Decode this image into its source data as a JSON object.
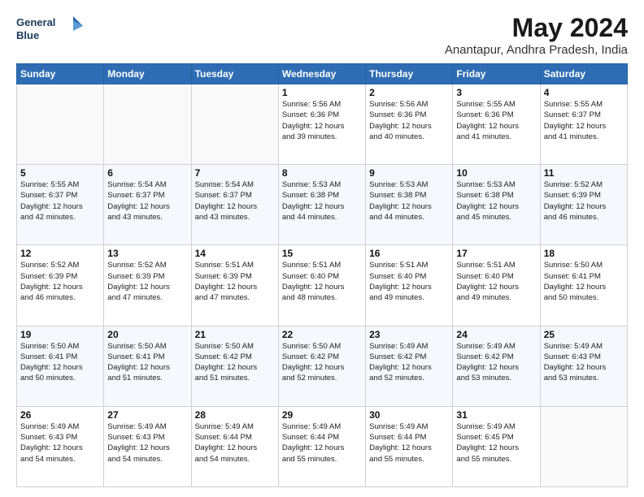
{
  "logo": {
    "line1": "General",
    "line2": "Blue"
  },
  "title": "May 2024",
  "subtitle": "Anantapur, Andhra Pradesh, India",
  "days_of_week": [
    "Sunday",
    "Monday",
    "Tuesday",
    "Wednesday",
    "Thursday",
    "Friday",
    "Saturday"
  ],
  "weeks": [
    [
      {
        "day": "",
        "info": ""
      },
      {
        "day": "",
        "info": ""
      },
      {
        "day": "",
        "info": ""
      },
      {
        "day": "1",
        "info": "Sunrise: 5:56 AM\nSunset: 6:36 PM\nDaylight: 12 hours\nand 39 minutes."
      },
      {
        "day": "2",
        "info": "Sunrise: 5:56 AM\nSunset: 6:36 PM\nDaylight: 12 hours\nand 40 minutes."
      },
      {
        "day": "3",
        "info": "Sunrise: 5:55 AM\nSunset: 6:36 PM\nDaylight: 12 hours\nand 41 minutes."
      },
      {
        "day": "4",
        "info": "Sunrise: 5:55 AM\nSunset: 6:37 PM\nDaylight: 12 hours\nand 41 minutes."
      }
    ],
    [
      {
        "day": "5",
        "info": "Sunrise: 5:55 AM\nSunset: 6:37 PM\nDaylight: 12 hours\nand 42 minutes."
      },
      {
        "day": "6",
        "info": "Sunrise: 5:54 AM\nSunset: 6:37 PM\nDaylight: 12 hours\nand 43 minutes."
      },
      {
        "day": "7",
        "info": "Sunrise: 5:54 AM\nSunset: 6:37 PM\nDaylight: 12 hours\nand 43 minutes."
      },
      {
        "day": "8",
        "info": "Sunrise: 5:53 AM\nSunset: 6:38 PM\nDaylight: 12 hours\nand 44 minutes."
      },
      {
        "day": "9",
        "info": "Sunrise: 5:53 AM\nSunset: 6:38 PM\nDaylight: 12 hours\nand 44 minutes."
      },
      {
        "day": "10",
        "info": "Sunrise: 5:53 AM\nSunset: 6:38 PM\nDaylight: 12 hours\nand 45 minutes."
      },
      {
        "day": "11",
        "info": "Sunrise: 5:52 AM\nSunset: 6:39 PM\nDaylight: 12 hours\nand 46 minutes."
      }
    ],
    [
      {
        "day": "12",
        "info": "Sunrise: 5:52 AM\nSunset: 6:39 PM\nDaylight: 12 hours\nand 46 minutes."
      },
      {
        "day": "13",
        "info": "Sunrise: 5:52 AM\nSunset: 6:39 PM\nDaylight: 12 hours\nand 47 minutes."
      },
      {
        "day": "14",
        "info": "Sunrise: 5:51 AM\nSunset: 6:39 PM\nDaylight: 12 hours\nand 47 minutes."
      },
      {
        "day": "15",
        "info": "Sunrise: 5:51 AM\nSunset: 6:40 PM\nDaylight: 12 hours\nand 48 minutes."
      },
      {
        "day": "16",
        "info": "Sunrise: 5:51 AM\nSunset: 6:40 PM\nDaylight: 12 hours\nand 49 minutes."
      },
      {
        "day": "17",
        "info": "Sunrise: 5:51 AM\nSunset: 6:40 PM\nDaylight: 12 hours\nand 49 minutes."
      },
      {
        "day": "18",
        "info": "Sunrise: 5:50 AM\nSunset: 6:41 PM\nDaylight: 12 hours\nand 50 minutes."
      }
    ],
    [
      {
        "day": "19",
        "info": "Sunrise: 5:50 AM\nSunset: 6:41 PM\nDaylight: 12 hours\nand 50 minutes."
      },
      {
        "day": "20",
        "info": "Sunrise: 5:50 AM\nSunset: 6:41 PM\nDaylight: 12 hours\nand 51 minutes."
      },
      {
        "day": "21",
        "info": "Sunrise: 5:50 AM\nSunset: 6:42 PM\nDaylight: 12 hours\nand 51 minutes."
      },
      {
        "day": "22",
        "info": "Sunrise: 5:50 AM\nSunset: 6:42 PM\nDaylight: 12 hours\nand 52 minutes."
      },
      {
        "day": "23",
        "info": "Sunrise: 5:49 AM\nSunset: 6:42 PM\nDaylight: 12 hours\nand 52 minutes."
      },
      {
        "day": "24",
        "info": "Sunrise: 5:49 AM\nSunset: 6:42 PM\nDaylight: 12 hours\nand 53 minutes."
      },
      {
        "day": "25",
        "info": "Sunrise: 5:49 AM\nSunset: 6:43 PM\nDaylight: 12 hours\nand 53 minutes."
      }
    ],
    [
      {
        "day": "26",
        "info": "Sunrise: 5:49 AM\nSunset: 6:43 PM\nDaylight: 12 hours\nand 54 minutes."
      },
      {
        "day": "27",
        "info": "Sunrise: 5:49 AM\nSunset: 6:43 PM\nDaylight: 12 hours\nand 54 minutes."
      },
      {
        "day": "28",
        "info": "Sunrise: 5:49 AM\nSunset: 6:44 PM\nDaylight: 12 hours\nand 54 minutes."
      },
      {
        "day": "29",
        "info": "Sunrise: 5:49 AM\nSunset: 6:44 PM\nDaylight: 12 hours\nand 55 minutes."
      },
      {
        "day": "30",
        "info": "Sunrise: 5:49 AM\nSunset: 6:44 PM\nDaylight: 12 hours\nand 55 minutes."
      },
      {
        "day": "31",
        "info": "Sunrise: 5:49 AM\nSunset: 6:45 PM\nDaylight: 12 hours\nand 55 minutes."
      },
      {
        "day": "",
        "info": ""
      }
    ]
  ]
}
